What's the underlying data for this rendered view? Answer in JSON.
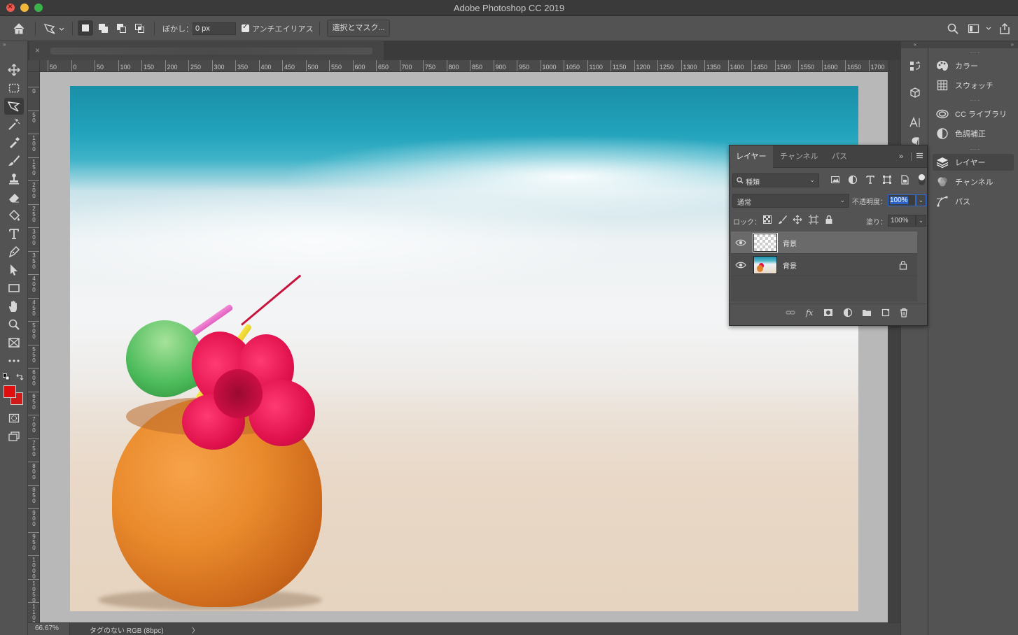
{
  "window": {
    "title": "Adobe Photoshop CC 2019"
  },
  "options_bar": {
    "feather_label": "ぼかし：",
    "feather_value": "0 px",
    "antialias_label": "アンチエイリアス",
    "antialias_checked": true,
    "select_mask_label": "選択とマスク..."
  },
  "rulers": {
    "horizontal_ticks": [
      "50",
      "0",
      "50",
      "100",
      "150",
      "200",
      "250",
      "300",
      "350",
      "400",
      "450",
      "500",
      "550",
      "600",
      "650",
      "700",
      "750",
      "800",
      "850",
      "900",
      "950",
      "1000",
      "1050",
      "1100",
      "1150",
      "1200",
      "1250",
      "1300",
      "1350",
      "1400",
      "1450",
      "1500",
      "1550",
      "1600",
      "1650",
      "1700"
    ],
    "vertical_ticks": [
      "0",
      "50",
      "100",
      "150",
      "200",
      "250",
      "300",
      "350",
      "400",
      "450",
      "500",
      "550",
      "600",
      "650",
      "700",
      "750",
      "800",
      "850",
      "900",
      "950",
      "1000",
      "1050",
      "1100"
    ]
  },
  "colors": {
    "foreground": "#e00f0f",
    "background": "#cf1a1a",
    "ui_dark": "#535353",
    "accent_blue": "#2d6ad2"
  },
  "right_panel": {
    "items": [
      {
        "label": "カラー",
        "icon": "palette-icon"
      },
      {
        "label": "スウォッチ",
        "icon": "grid-icon"
      },
      {
        "label": "CC ライブラリ",
        "icon": "cc-library-icon"
      },
      {
        "label": "色調補正",
        "icon": "adjustment-icon"
      },
      {
        "label": "レイヤー",
        "icon": "layers-icon"
      },
      {
        "label": "チャンネル",
        "icon": "channels-icon"
      },
      {
        "label": "パス",
        "icon": "paths-icon"
      }
    ]
  },
  "layers_panel": {
    "tabs": [
      "レイヤー",
      "チャンネル",
      "パス"
    ],
    "filter_label": "種類",
    "blend_mode": "通常",
    "opacity_label": "不透明度：",
    "opacity_value": "100%",
    "lock_label": "ロック：",
    "fill_label": "塗り：",
    "fill_value": "100%",
    "layers": [
      {
        "name": "背景",
        "selected": true,
        "locked": false,
        "thumbnail": "transparent"
      },
      {
        "name": "背景",
        "selected": false,
        "locked": true,
        "thumbnail": "image"
      }
    ]
  },
  "status_bar": {
    "zoom": "66.67%",
    "doc_info": "タグのない RGB (8bpc)",
    "arrow": "〉"
  }
}
